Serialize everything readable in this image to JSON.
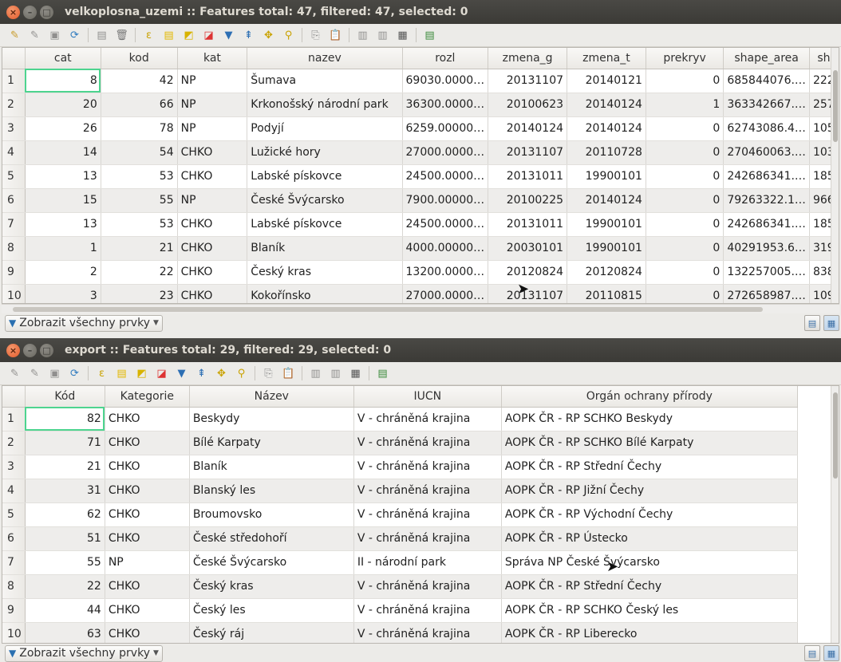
{
  "win1": {
    "title": "velkoplosna_uzemi :: Features total: 47, filtered: 47, selected: 0",
    "columns": [
      "cat",
      "kod",
      "kat",
      "nazev",
      "rozl",
      "zmena_g",
      "zmena_t",
      "prekryv",
      "shape_area",
      "sh"
    ],
    "rows": [
      [
        "1",
        "8",
        "42",
        "NP",
        "Šumava",
        "69030.0000…",
        "20131107",
        "20140121",
        "0",
        "685844076.…",
        "222"
      ],
      [
        "2",
        "20",
        "66",
        "NP",
        "Krkonošský národní park",
        "36300.0000…",
        "20100623",
        "20140124",
        "1",
        "363342667.…",
        "257"
      ],
      [
        "3",
        "26",
        "78",
        "NP",
        "Podyjí",
        "6259.00000…",
        "20140124",
        "20140124",
        "0",
        "62743086.4…",
        "105"
      ],
      [
        "4",
        "14",
        "54",
        "CHKO",
        "Lužické hory",
        "27000.0000…",
        "20131107",
        "20110728",
        "0",
        "270460063.…",
        "103"
      ],
      [
        "5",
        "13",
        "53",
        "CHKO",
        "Labské pískovce",
        "24500.0000…",
        "20131011",
        "19900101",
        "0",
        "242686341.…",
        "185"
      ],
      [
        "6",
        "15",
        "55",
        "NP",
        "České Švýcarsko",
        "7900.00000…",
        "20100225",
        "20140124",
        "0",
        "79263322.1…",
        "966"
      ],
      [
        "7",
        "13",
        "53",
        "CHKO",
        "Labské pískovce",
        "24500.0000…",
        "20131011",
        "19900101",
        "0",
        "242686341.…",
        "185"
      ],
      [
        "8",
        "1",
        "21",
        "CHKO",
        "Blaník",
        "4000.00000…",
        "20030101",
        "19900101",
        "0",
        "40291953.6…",
        "319"
      ],
      [
        "9",
        "2",
        "22",
        "CHKO",
        "Český kras",
        "13200.0000…",
        "20120824",
        "20120824",
        "0",
        "132257005.…",
        "838"
      ],
      [
        "10",
        "3",
        "23",
        "CHKO",
        "Kokořínsko",
        "27000.0000…",
        "20131107",
        "20110815",
        "0",
        "272658987.…",
        "109"
      ]
    ],
    "filter_label": "Zobrazit všechny prvky"
  },
  "win2": {
    "title": "export :: Features total: 29, filtered: 29, selected: 0",
    "columns": [
      "Kód",
      "Kategorie",
      "Název",
      "IUCN",
      "Orgán ochrany přírody"
    ],
    "rows": [
      [
        "1",
        "82",
        "CHKO",
        "Beskydy",
        "V - chráněná krajina",
        "AOPK ČR - RP SCHKO Beskydy"
      ],
      [
        "2",
        "71",
        "CHKO",
        "Bílé Karpaty",
        "V - chráněná krajina",
        "AOPK ČR - RP SCHKO Bílé Karpaty"
      ],
      [
        "3",
        "21",
        "CHKO",
        "Blaník",
        "V - chráněná krajina",
        "AOPK ČR - RP Střední Čechy"
      ],
      [
        "4",
        "31",
        "CHKO",
        "Blanský les",
        "V - chráněná krajina",
        "AOPK ČR - RP Jižní Čechy"
      ],
      [
        "5",
        "62",
        "CHKO",
        "Broumovsko",
        "V - chráněná krajina",
        "AOPK ČR - RP Východní Čechy"
      ],
      [
        "6",
        "51",
        "CHKO",
        "České středohoří",
        "V - chráněná krajina",
        "AOPK ČR - RP Ústecko"
      ],
      [
        "7",
        "55",
        "NP",
        "České Švýcarsko",
        "II - národní park",
        "Správa NP České Švýcarsko"
      ],
      [
        "8",
        "22",
        "CHKO",
        "Český kras",
        "V - chráněná krajina",
        "AOPK ČR - RP Střední Čechy"
      ],
      [
        "9",
        "44",
        "CHKO",
        "Český les",
        "V - chráněná krajina",
        "AOPK ČR - RP SCHKO Český les"
      ],
      [
        "10",
        "63",
        "CHKO",
        "Český ráj",
        "V - chráněná krajina",
        "AOPK ČR - RP Liberecko"
      ]
    ],
    "filter_label": "Zobrazit všechny prvky"
  },
  "titlebar_buttons": {
    "close": "×",
    "minimize": "–",
    "maximize": "□"
  },
  "toolbar_icons": [
    "pencil-icon",
    "save-edits-icon",
    "save-icon",
    "reload-icon",
    "add-feature-icon",
    "delete-icon",
    "expression-select-icon",
    "select-all-icon",
    "invert-selection-icon",
    "deselect-icon",
    "filter-icon",
    "move-to-top-icon",
    "pan-to-selection-icon",
    "zoom-to-selection-icon",
    "copy-icon",
    "paste-icon",
    "new-field-icon",
    "delete-field-icon",
    "field-calculator-icon",
    "conditional-format-icon"
  ],
  "view_buttons": {
    "form": "▤",
    "table": "▦"
  }
}
